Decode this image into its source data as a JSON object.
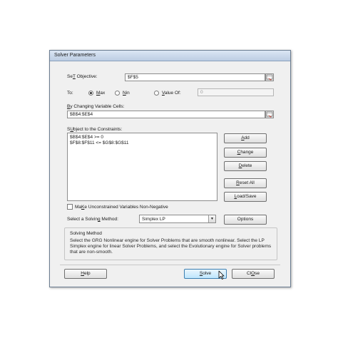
{
  "window": {
    "title": "Solver Parameters"
  },
  "objective": {
    "label_accel": "T",
    "label_rest": "Set Objective:",
    "label_pre": "Se",
    "label_post": " Objective:",
    "value": "$F$5"
  },
  "to": {
    "label": "To:",
    "options": [
      {
        "accel": "M",
        "rest": "ax",
        "selected": true
      },
      {
        "accel": "N",
        "rest": "in",
        "selected": false
      },
      {
        "accel": "V",
        "rest": "alue Of:",
        "selected": false
      }
    ],
    "value_of": "0"
  },
  "changing_cells": {
    "label_accel": "B",
    "label_rest": "y Changing Variable Cells:",
    "value": "$B$4:$E$4"
  },
  "constraints": {
    "label_accel": "U",
    "label_pre": "S",
    "label_rest": "bject to the Constraints:",
    "items": [
      "$B$4:$E$4 >= 0",
      "$F$8:$F$11 <= $G$8:$G$11"
    ]
  },
  "side_buttons": {
    "add": {
      "accel": "A",
      "rest": "dd"
    },
    "change": {
      "accel": "C",
      "rest": "hange"
    },
    "delete": {
      "accel": "D",
      "rest": "elete"
    },
    "reset_all": {
      "accel": "R",
      "rest": "eset All"
    },
    "load_save": {
      "accel": "L",
      "rest": "oad/Save"
    },
    "options": {
      "label": "Options"
    }
  },
  "unconstrained": {
    "accel": "K",
    "pre": "Ma",
    "rest": "e Unconstrained Variables Non-Negative",
    "checked": false
  },
  "solving_method": {
    "label_pre": "Select a Solvin",
    "label_accel": "g",
    "label_rest": " Method:",
    "selected": "Simplex LP"
  },
  "method_box": {
    "title": "Solving Method",
    "description": "Select the GRG Nonlinear engine for Solver Problems that are smooth nonlinear. Select the LP Simplex engine for linear Solver Problems, and select the Evolutionary engine for Solver problems that are non-smooth."
  },
  "footer": {
    "help": {
      "accel": "H",
      "rest": "elp"
    },
    "solve": {
      "accel": "S",
      "rest": "olve"
    },
    "close": {
      "accel": "O",
      "pre": "Cl",
      "rest": "se"
    }
  }
}
